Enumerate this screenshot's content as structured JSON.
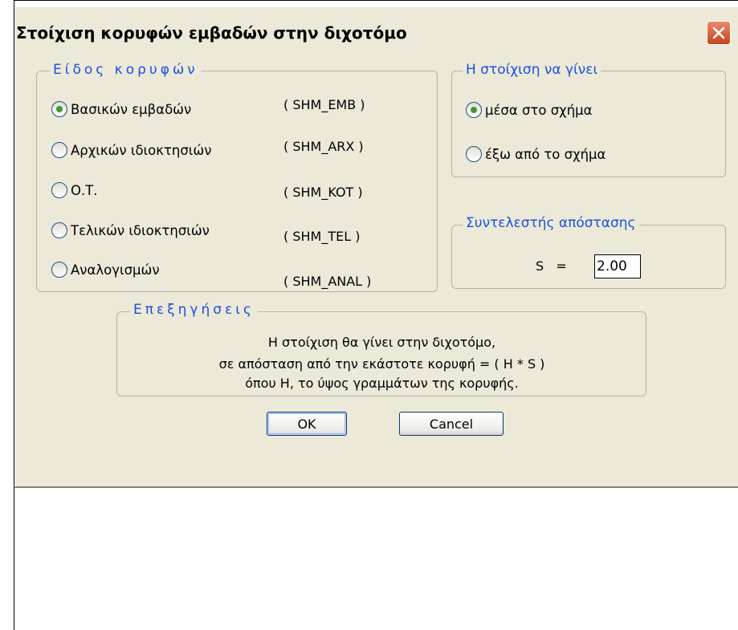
{
  "dialog": {
    "title": "Στοίχιση κορυφών εμβαδών στην διχοτόμο",
    "close_icon": "close-icon",
    "close_color": "#c9401f"
  },
  "vertex_type": {
    "legend": "Είδος κορυφών",
    "options": [
      {
        "label": "Βασικών εμβαδών",
        "code": "( SHM_EMB )",
        "checked": true
      },
      {
        "label": "Αρχικών ιδιοκτησιών",
        "code": "( SHM_ARX )",
        "checked": false
      },
      {
        "label": "Ο.Τ.",
        "code": "( SHM_KOT )",
        "checked": false
      },
      {
        "label": "Τελικών ιδιοκτησιών",
        "code": "( SHM_TEL )",
        "checked": false
      },
      {
        "label": "Αναλογισμών",
        "code": "( SHM_ANAL )",
        "checked": false
      }
    ]
  },
  "alignment": {
    "legend": "Η στοίχιση να γίνει",
    "options": [
      {
        "label": "μέσα στο σχήμα",
        "checked": true
      },
      {
        "label": "έξω από το σχήμα",
        "checked": false
      }
    ]
  },
  "distance": {
    "legend": "Συντελεστής απόστασης",
    "label": "S   =",
    "value": "2.00"
  },
  "explanation": {
    "legend": "Επεξηγήσεις",
    "lines": [
      "Η στοίχιση θα γίνει στην διχοτόμο,",
      "σε απόσταση από την εκάστοτε κορυφή  =  ( H * S )",
      "όπου Η, το ύψος γραμμάτων της κορυφής."
    ]
  },
  "buttons": {
    "ok": "OK",
    "cancel": "Cancel"
  },
  "colors": {
    "legend_text": "#1c4fe0",
    "dialog_bg": "#ece9d8",
    "radio_dot": "#3d9b32"
  }
}
